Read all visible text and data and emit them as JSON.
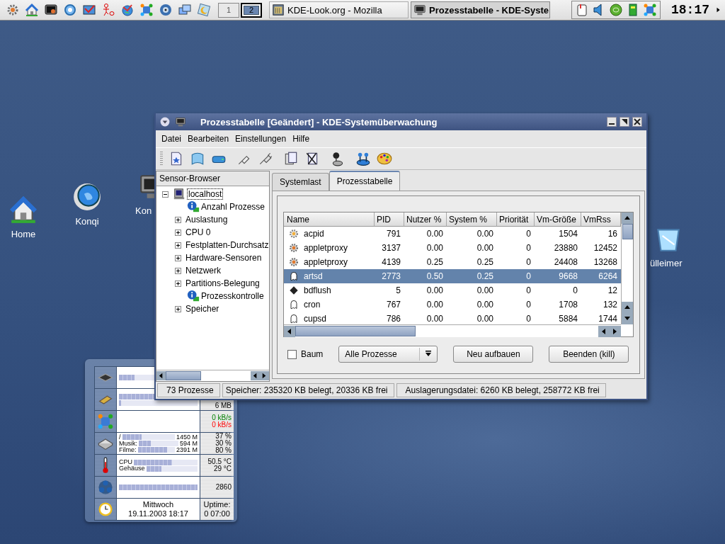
{
  "taskbar": {
    "launchers": [
      {
        "kind": "kgear"
      },
      {
        "kind": "house"
      },
      {
        "kind": "terminal"
      },
      {
        "kind": "lifebuoy"
      },
      {
        "kind": "mail"
      },
      {
        "kind": "figure"
      },
      {
        "kind": "globe"
      },
      {
        "kind": "network"
      },
      {
        "kind": "disc"
      },
      {
        "kind": "windows"
      },
      {
        "kind": "moon"
      }
    ],
    "pager": [
      {
        "label": "1",
        "selected": false
      },
      {
        "label": "2",
        "selected": true
      }
    ],
    "tasks": [
      {
        "title": "KDE-Look.org - Mozilla",
        "kind": "browser",
        "selected": false
      },
      {
        "title": "Prozesstabelle - KDE-Syste",
        "kind": "monitor",
        "selected": true
      }
    ],
    "tray": [
      {
        "kind": "clipboard"
      },
      {
        "kind": "speaker"
      },
      {
        "kind": "greenball"
      },
      {
        "kind": "board"
      },
      {
        "kind": "network"
      }
    ],
    "clock": "18:17"
  },
  "desktop_icons": [
    {
      "label": "Home",
      "kind": "house"
    },
    {
      "label": "Konqi",
      "kind": "konqi"
    },
    {
      "label": "Kon",
      "kind": "monitor"
    },
    {
      "label": "ülleimer",
      "kind": "trash"
    }
  ],
  "window": {
    "title": "Prozesstabelle [Geändert] - KDE-Systemüberwachung",
    "menu": [
      "Datei",
      "Bearbeiten",
      "Einstellungen",
      "Hilfe"
    ],
    "toolbar": [
      {
        "kind": "newdoc"
      },
      {
        "kind": "sheet"
      },
      {
        "kind": "drive"
      },
      {
        "kind": "plug"
      },
      {
        "kind": "plug2"
      },
      {
        "kind": "pages"
      },
      {
        "kind": "tools"
      },
      {
        "kind": "joystick"
      },
      {
        "kind": "joysticks"
      },
      {
        "kind": "palette"
      }
    ],
    "sensor_browser": {
      "title": "Sensor-Browser",
      "tree": [
        {
          "label": "localhost",
          "kind": "host",
          "expanded": true,
          "selected": true,
          "children": [
            {
              "label": "Anzahl Prozesse",
              "kind": "info",
              "selected": false
            },
            {
              "label": "Auslastung",
              "kind": "group",
              "expanded": false,
              "selected": false
            },
            {
              "label": "CPU 0",
              "kind": "group",
              "expanded": false,
              "selected": false
            },
            {
              "label": "Festplatten-Durchsatz",
              "kind": "group",
              "expanded": false,
              "selected": false
            },
            {
              "label": "Hardware-Sensoren",
              "kind": "group",
              "expanded": false,
              "selected": false
            },
            {
              "label": "Netzwerk",
              "kind": "group",
              "expanded": false,
              "selected": false
            },
            {
              "label": "Partitions-Belegung",
              "kind": "group",
              "expanded": false,
              "selected": false
            },
            {
              "label": "Prozesskontrolle",
              "kind": "info",
              "selected": false
            },
            {
              "label": "Speicher",
              "kind": "group",
              "expanded": false,
              "selected": false
            }
          ]
        }
      ]
    },
    "tabs": [
      {
        "label": "Systemlast",
        "selected": false
      },
      {
        "label": "Prozesstabelle",
        "selected": true
      }
    ],
    "table": {
      "columns": [
        "Name",
        "PID",
        "Nutzer %",
        "System %",
        "Priorität",
        "Vm-Größe",
        "VmRss"
      ],
      "rows": [
        {
          "kind": "gear",
          "cells": [
            "acpid",
            "791",
            "0.00",
            "0.00",
            "0",
            "1504",
            "16"
          ],
          "selected": false
        },
        {
          "kind": "kgear",
          "cells": [
            "appletproxy",
            "3137",
            "0.00",
            "0.00",
            "0",
            "23880",
            "12452"
          ],
          "selected": false
        },
        {
          "kind": "kgear",
          "cells": [
            "appletproxy",
            "4139",
            "0.25",
            "0.25",
            "0",
            "24408",
            "13268"
          ],
          "selected": false
        },
        {
          "kind": "ghost",
          "cells": [
            "artsd",
            "2773",
            "0.50",
            "0.25",
            "0",
            "9668",
            "6264"
          ],
          "selected": true
        },
        {
          "kind": "chip",
          "cells": [
            "bdflush",
            "5",
            "0.00",
            "0.00",
            "0",
            "0",
            "12"
          ],
          "selected": false
        },
        {
          "kind": "ghost",
          "cells": [
            "cron",
            "767",
            "0.00",
            "0.00",
            "0",
            "1708",
            "132"
          ],
          "selected": false
        },
        {
          "kind": "ghost",
          "cells": [
            "cupsd",
            "786",
            "0.00",
            "0.00",
            "0",
            "5884",
            "1744"
          ],
          "selected": false
        }
      ]
    },
    "tree_checkbox": {
      "label": "Baum",
      "checked": false
    },
    "filter": {
      "value": "Alle Prozesse"
    },
    "buttons": [
      "Neu aufbauen",
      "Beenden (kill)"
    ],
    "status_bar": [
      "73 Prozesse",
      "Speicher: 235320 KB belegt, 20336 KB frei",
      "Auslagerungsdatei: 6260 KB belegt, 258772 KB frei"
    ]
  },
  "monitor_applet": {
    "rows": [
      {
        "kind": "cpu",
        "lines": [
          {
            "level": 0.2
          }
        ]
      },
      {
        "kind": "memory",
        "lines": [
          {
            "level": 0.95
          },
          {
            "level": 0.03
          }
        ],
        "readings": [
          {
            "text": "6 MB"
          }
        ]
      },
      {
        "kind": "network",
        "readings": [
          {
            "text": "0 kB/s",
            "color": "#008000"
          },
          {
            "text": "0 kB/s",
            "color": "#ff0000"
          }
        ]
      },
      {
        "kind": "disk",
        "lines": [
          {
            "label": "/",
            "level": 0.37,
            "value": "1450 M"
          },
          {
            "label": "Musik:",
            "level": 0.3,
            "value": "594 M"
          },
          {
            "label": "Filme:",
            "level": 0.8,
            "value": "2391 M"
          }
        ],
        "readings": [
          {
            "text": "37 %"
          },
          {
            "text": "30 %"
          },
          {
            "text": "80 %"
          }
        ]
      },
      {
        "kind": "temperature",
        "lines": [
          {
            "label": "CPU",
            "level": 0.6
          },
          {
            "label": "Gehäuse",
            "level": 0.3
          }
        ],
        "readings": [
          {
            "text": "50.5 °C"
          },
          {
            "text": "29 °C"
          }
        ]
      },
      {
        "kind": "fan",
        "lines": [
          {
            "level": 1.0
          }
        ],
        "readings": [
          {
            "text": "2860"
          }
        ]
      },
      {
        "kind": "clock",
        "texts": [
          "Mittwoch",
          "19.11.2003 18:17"
        ],
        "readings": [
          {
            "text": "Uptime:"
          },
          {
            "text": "0 07:00"
          }
        ]
      }
    ]
  }
}
